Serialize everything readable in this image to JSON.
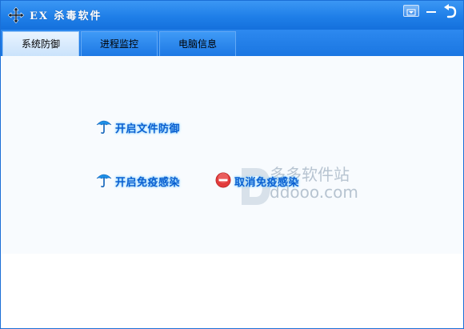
{
  "window": {
    "title": "EX 杀毒软件"
  },
  "tabs": [
    {
      "label": "系统防御",
      "active": true
    },
    {
      "label": "进程监控",
      "active": false
    },
    {
      "label": "电脑信息",
      "active": false
    }
  ],
  "actions": {
    "file_defense": "开启文件防御",
    "immune_infection": "开启免疫感染",
    "cancel_immune": "取消免疫感染"
  },
  "watermark": {
    "name": "多多软件站",
    "url": "ddooo.com"
  },
  "colors": {
    "titlebar": "#1f7fe8",
    "accent_text": "#0a5fd0",
    "cancel_icon": "#e23b3b"
  }
}
